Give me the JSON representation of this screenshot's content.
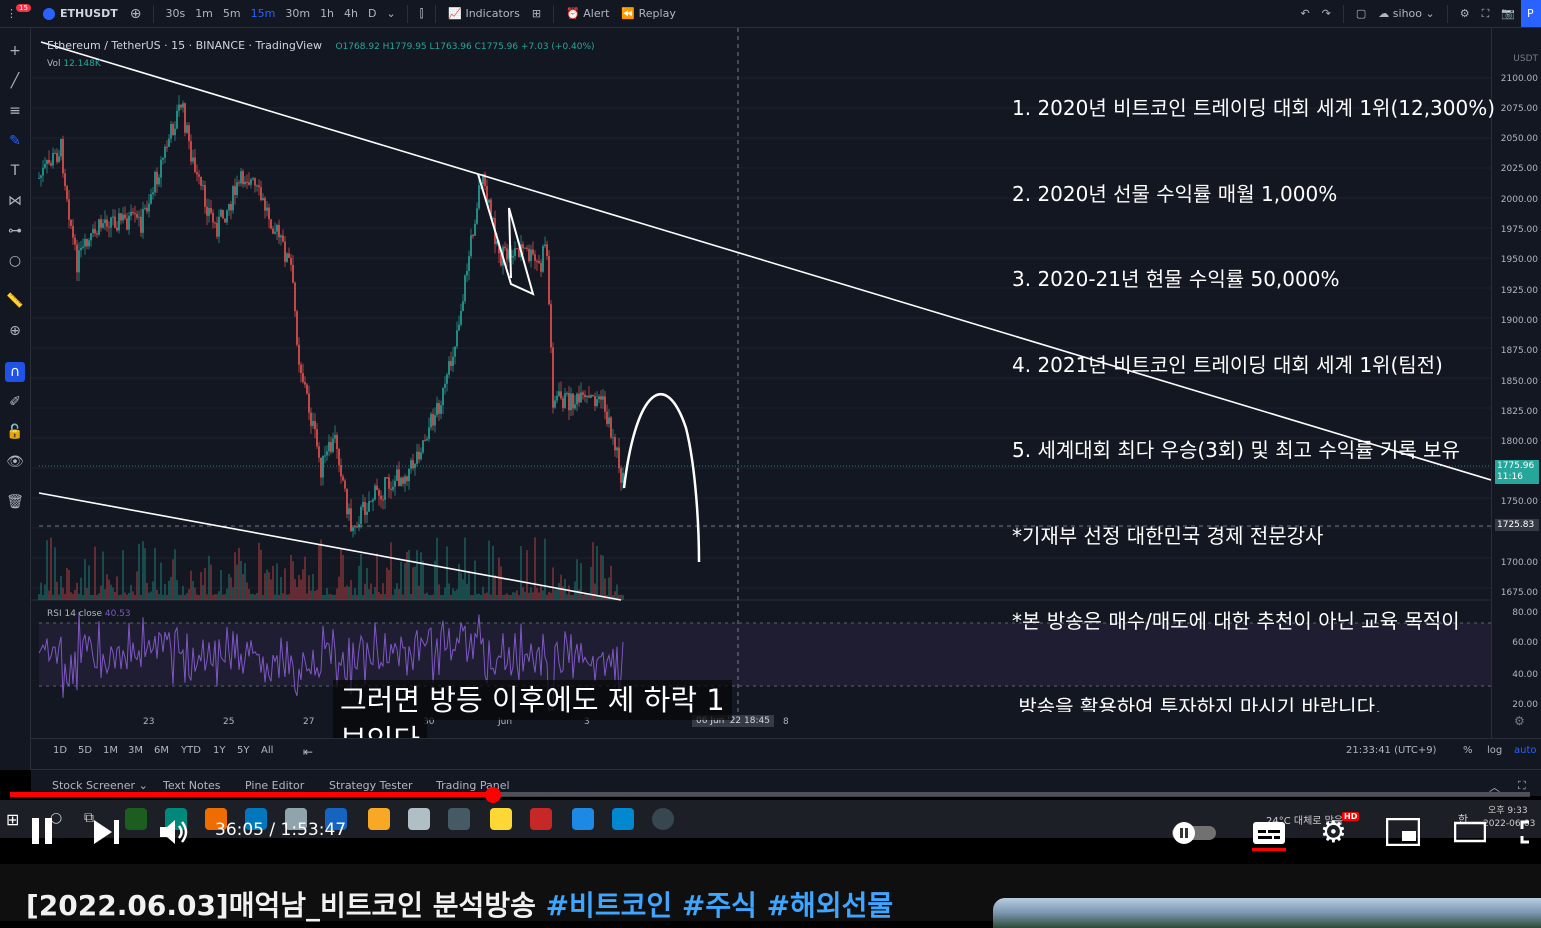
{
  "toolbar": {
    "badge": "15",
    "symbol": "ETHUSDT",
    "timeframes": [
      "30s",
      "1m",
      "5m",
      "15m",
      "30m",
      "1h",
      "4h",
      "D"
    ],
    "active_timeframe": "15m",
    "indicators_label": "Indicators",
    "alert_label": "Alert",
    "replay_label": "Replay",
    "user_label": "sihoo",
    "publish_label": "P"
  },
  "legend": {
    "title": "Ethereum / TetherUS · 15 · BINANCE · TradingView",
    "ohlc": "O1768.92 H1779.95 L1763.96 C1775.96 +7.03 (+0.40%)",
    "vol_label": "Vol",
    "vol_value": "12.148K",
    "rsi_label": "RSI 14 close",
    "rsi_value": "40.53"
  },
  "price_scale": {
    "unit": "USDT",
    "labels": [
      "2100.00",
      "2075.00",
      "2050.00",
      "2025.00",
      "2000.00",
      "1975.00",
      "1950.00",
      "1925.00",
      "1900.00",
      "1875.00",
      "1850.00",
      "1825.00",
      "1800.00",
      "1750.00",
      "1700.00",
      "1675.00"
    ],
    "current_price": "1775.96",
    "countdown": "11:16",
    "crosshair_price": "1725.83",
    "rsi_labels": [
      "80.00",
      "60.00",
      "40.00",
      "20.00"
    ]
  },
  "overlay_text": [
    "1. 2020년 비트코인 트레이딩 대회 세계 1위(12,300%)",
    "2. 2020년 선물 수익률 매월 1,000%",
    "3. 2020-21년 현물 수익률 50,000%",
    "4. 2021년 비트코인 트레이딩 대회 세계 1위(팀전)",
    "5. 세계대회 최다 우승(3회) 및 최고 수익률 기록 보유",
    "*기재부 선정 대한민국 경제 전문강사",
    "*본 방송은 매수/매도에 대한 추천이 아닌 교육 목적이",
    " 방송을 활용하여 투자하지 마시기 바랍니다."
  ],
  "subtitles": [
    "그러면 방등 이후에도 제 하락 1",
    "보인다"
  ],
  "xaxis": {
    "labels": [
      "23",
      "25",
      "27",
      "30",
      "Jun",
      "3",
      "8"
    ],
    "cursor": "06 Jun '22   18:45"
  },
  "range_bar": {
    "ranges": [
      "1D",
      "5D",
      "1M",
      "3M",
      "6M",
      "YTD",
      "1Y",
      "5Y",
      "All"
    ],
    "clock": "21:33:41 (UTC+9)",
    "percent": "%",
    "log": "log",
    "auto": "auto"
  },
  "bottom_tabs": [
    "Stock Screener",
    "Text Notes",
    "Pine Editor",
    "Strategy Tester",
    "Trading Panel"
  ],
  "taskbar": {
    "weather": "24°C 대체로 맑음",
    "clock_time": "오후 9:33",
    "clock_date": "2022-06-03",
    "ime": "한"
  },
  "player": {
    "time_current": "36:05",
    "time_total": "1:53:47",
    "progress": 0.3175,
    "hd_badge": "HD"
  },
  "video": {
    "title_main": "[2022.06.03]매억남_비트코인 분석방송 ",
    "hashtags": [
      "#비트코인",
      "#주식",
      "#해외선물"
    ]
  },
  "colors": {
    "accent": "#2962ff",
    "up": "#26a69a",
    "down": "#ef5350",
    "rsi": "#7e57c2",
    "progress": "#ff0000"
  }
}
